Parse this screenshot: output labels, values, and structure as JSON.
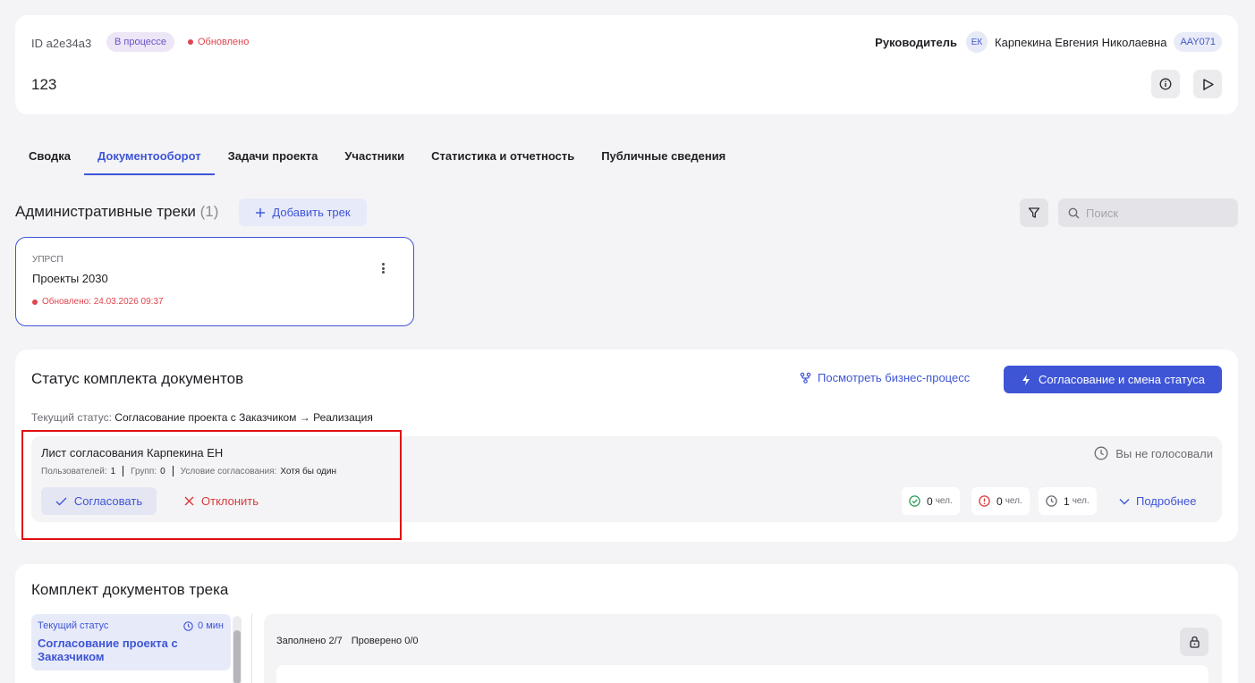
{
  "header": {
    "id_label": "ID a2e34a3",
    "status_badge": "В процессе",
    "updated_label": "Обновлено",
    "project_title": "123",
    "manager_label": "Руководитель",
    "manager_initials": "ЕК",
    "manager_name": "Карпекина Евгения Николаевна",
    "manager_code": "AAY071"
  },
  "tabs": [
    {
      "label": "Сводка",
      "active": false
    },
    {
      "label": "Документооборот",
      "active": true
    },
    {
      "label": "Задачи проекта",
      "active": false
    },
    {
      "label": "Участники",
      "active": false
    },
    {
      "label": "Статистика и отчетность",
      "active": false
    },
    {
      "label": "Публичные сведения",
      "active": false
    }
  ],
  "admin_tracks": {
    "title": "Административные треки",
    "count": "(1)",
    "add_button": "Добавить трек",
    "search_placeholder": "Поиск",
    "track": {
      "org": "УПРСП",
      "name": "Проекты 2030",
      "updated": "Обновлено: 24.03.2026 09:37"
    }
  },
  "status_section": {
    "title": "Статус комплекта документов",
    "bp_link": "Посмотреть бизнес-процесс",
    "approve_status_button": "Согласование и смена статуса",
    "current_status_label": "Текущий статус:",
    "current_status_value": "Согласование проекта с Заказчиком → Реализация",
    "approval_sheet": {
      "title": "Лист согласования Карпекина ЕН",
      "users_label": "Пользователей:",
      "users_value": "1",
      "groups_label": "Групп:",
      "groups_value": "0",
      "condition_label": "Условие согласования:",
      "condition_value": "Хотя бы один",
      "approve_button": "Согласовать",
      "reject_button": "Отклонить",
      "vote_status": "Вы не голосовали",
      "approved_count": "0",
      "rejected_count": "0",
      "pending_count": "1",
      "unit": "чел.",
      "details_link": "Подробнее"
    }
  },
  "docs_section": {
    "title": "Комплект документов трека",
    "stage_label": "Текущий статус",
    "stage_time": "0 мин",
    "stage_name": "Согласование проекта с Заказчиком",
    "filled": "Заполнено 2/7",
    "checked": "Проверено 0/0"
  },
  "colors": {
    "accent": "#3e55d6",
    "danger": "#e0454d",
    "success": "#2e9b5a",
    "highlight": "#e01010"
  }
}
